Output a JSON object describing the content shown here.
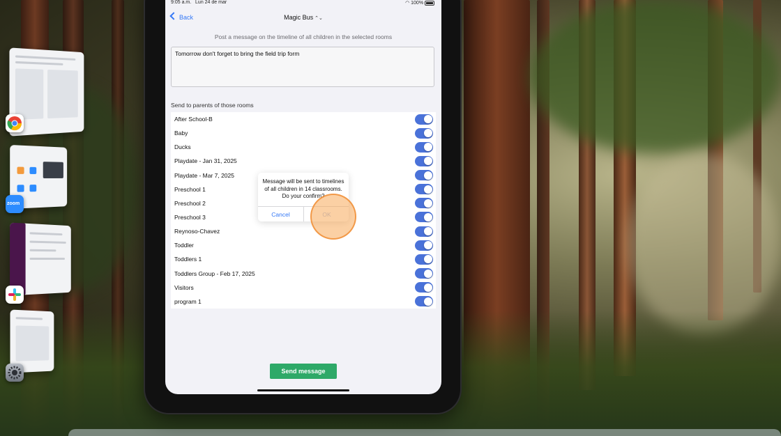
{
  "status_bar": {
    "time": "9:05 a.m.",
    "date": "Lun 24 de mar",
    "battery": "100%"
  },
  "nav": {
    "back_label": "Back",
    "title": "Magic Bus",
    "title_icon": "chevron-up-down-icon"
  },
  "form": {
    "subtitle": "Post a message on the timeline of all children in the selected rooms",
    "message_value": "Tomorrow don't forget to bring the field trip form",
    "section_label": "Send to parents of those rooms",
    "send_button": "Send message"
  },
  "rooms": [
    {
      "label": "After School-B",
      "enabled": true
    },
    {
      "label": "Baby",
      "enabled": true
    },
    {
      "label": "Ducks",
      "enabled": true
    },
    {
      "label": "Playdate - Jan 31, 2025",
      "enabled": true
    },
    {
      "label": "Playdate - Mar 7, 2025",
      "enabled": true
    },
    {
      "label": "Preschool 1",
      "enabled": true
    },
    {
      "label": "Preschool 2",
      "enabled": true
    },
    {
      "label": "Preschool 3",
      "enabled": true
    },
    {
      "label": "Reynoso-Chavez",
      "enabled": true
    },
    {
      "label": "Toddler",
      "enabled": true
    },
    {
      "label": "Toddlers 1",
      "enabled": true
    },
    {
      "label": "Toddlers Group - Feb 17, 2025",
      "enabled": true
    },
    {
      "label": "Visitors",
      "enabled": true
    },
    {
      "label": "program 1",
      "enabled": true
    }
  ],
  "alert": {
    "message": "Message will be sent to timelines of all children in 14 classrooms. Do your confirm?",
    "cancel_label": "Cancel",
    "ok_label": "OK"
  },
  "stage_apps": [
    "chrome-icon",
    "zoom-icon",
    "slack-icon",
    "settings-icon"
  ],
  "zoom_label": "zoom",
  "colors": {
    "accent": "#3478f6",
    "toggle_on": "#4a72d9",
    "send_button": "#2ea968",
    "tap_indicator": "#f7aa5a"
  }
}
